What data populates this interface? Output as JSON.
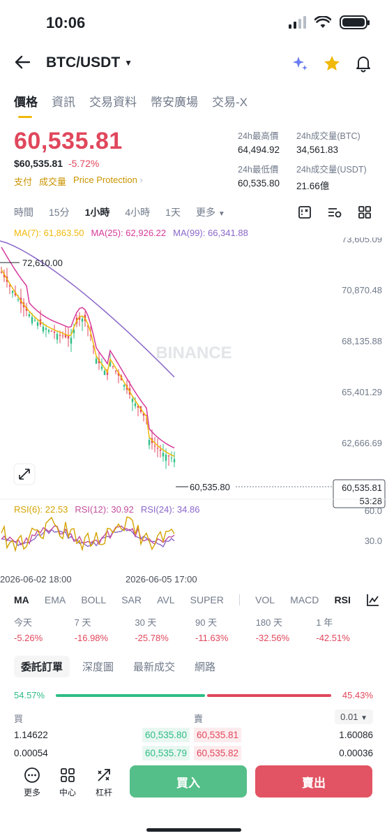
{
  "status": {
    "time": "10:06"
  },
  "header": {
    "pair": "BTC/USDT"
  },
  "tabs": [
    "價格",
    "資訊",
    "交易資料",
    "幣安廣場",
    "交易-X"
  ],
  "price": {
    "last": "60,535.81",
    "usd": "$60,535.81",
    "change_pct": "-5.72%",
    "links": [
      "支付",
      "成交量",
      "Price Protection"
    ]
  },
  "stats": {
    "high_label": "24h最高價",
    "high": "64,494.92",
    "vol_btc_label": "24h成交量(BTC)",
    "vol_btc": "34,561.83",
    "low_label": "24h最低價",
    "low": "60,535.80",
    "vol_usdt_label": "24h成交量(USDT)",
    "vol_usdt": "21.66億"
  },
  "intervals": [
    "時間",
    "15分",
    "1小時",
    "4小時",
    "1天",
    "更多"
  ],
  "ma": {
    "ma7": "MA(7): 61,863.50",
    "ma25": "MA(25): 62,926.22",
    "ma99": "MA(99): 66,341.88"
  },
  "chart": {
    "y_ticks": [
      "73,605.09",
      "70,870.48",
      "68,135.88",
      "65,401.29",
      "62,666.69"
    ],
    "high_marker": "72,610.00",
    "last_marker": "60,535.80",
    "price_tag": "60,535.81",
    "countdown": "53:28",
    "watermark": "BINANCE",
    "rsi_ticks": [
      "60.0",
      "30.0"
    ],
    "dates": [
      "2026-06-02 18:00",
      "2026-06-05 17:00"
    ]
  },
  "rsi": {
    "rsi6": "RSI(6): 22.53",
    "rsi12": "RSI(12): 30.92",
    "rsi24": "RSI(24): 34.86"
  },
  "indicators": [
    "MA",
    "EMA",
    "BOLL",
    "SAR",
    "AVL",
    "SUPER",
    "VOL",
    "MACD",
    "RSI"
  ],
  "performance": [
    {
      "label": "今天",
      "value": "-5.26%"
    },
    {
      "label": "7 天",
      "value": "-16.98%"
    },
    {
      "label": "30 天",
      "value": "-25.78%"
    },
    {
      "label": "90 天",
      "value": "-11.63%"
    },
    {
      "label": "180 天",
      "value": "-32.56%"
    },
    {
      "label": "1 年",
      "value": "-42.51%"
    }
  ],
  "book_tabs": [
    "委託訂單",
    "深度圖",
    "最新成交",
    "網路"
  ],
  "ratio": {
    "buy": "54.57%",
    "sell": "45.43%",
    "buy_fraction": 0.5457
  },
  "orderbook": {
    "buy_label": "買",
    "sell_label": "賣",
    "tick": "0.01",
    "rows": [
      {
        "bid_qty": "1.14622",
        "bid": "60,535.80",
        "ask": "60,535.81",
        "ask_qty": "1.60086"
      },
      {
        "bid_qty": "0.00054",
        "bid": "60,535.79",
        "ask": "60,535.82",
        "ask_qty": "0.00036"
      }
    ]
  },
  "bottom_nav": [
    "更多",
    "中心",
    "杠杆"
  ],
  "actions": {
    "buy": "買入",
    "sell": "賣出"
  },
  "colors": {
    "up": "#2ebd85",
    "down": "#e0475c",
    "accent": "#f0b90b"
  }
}
